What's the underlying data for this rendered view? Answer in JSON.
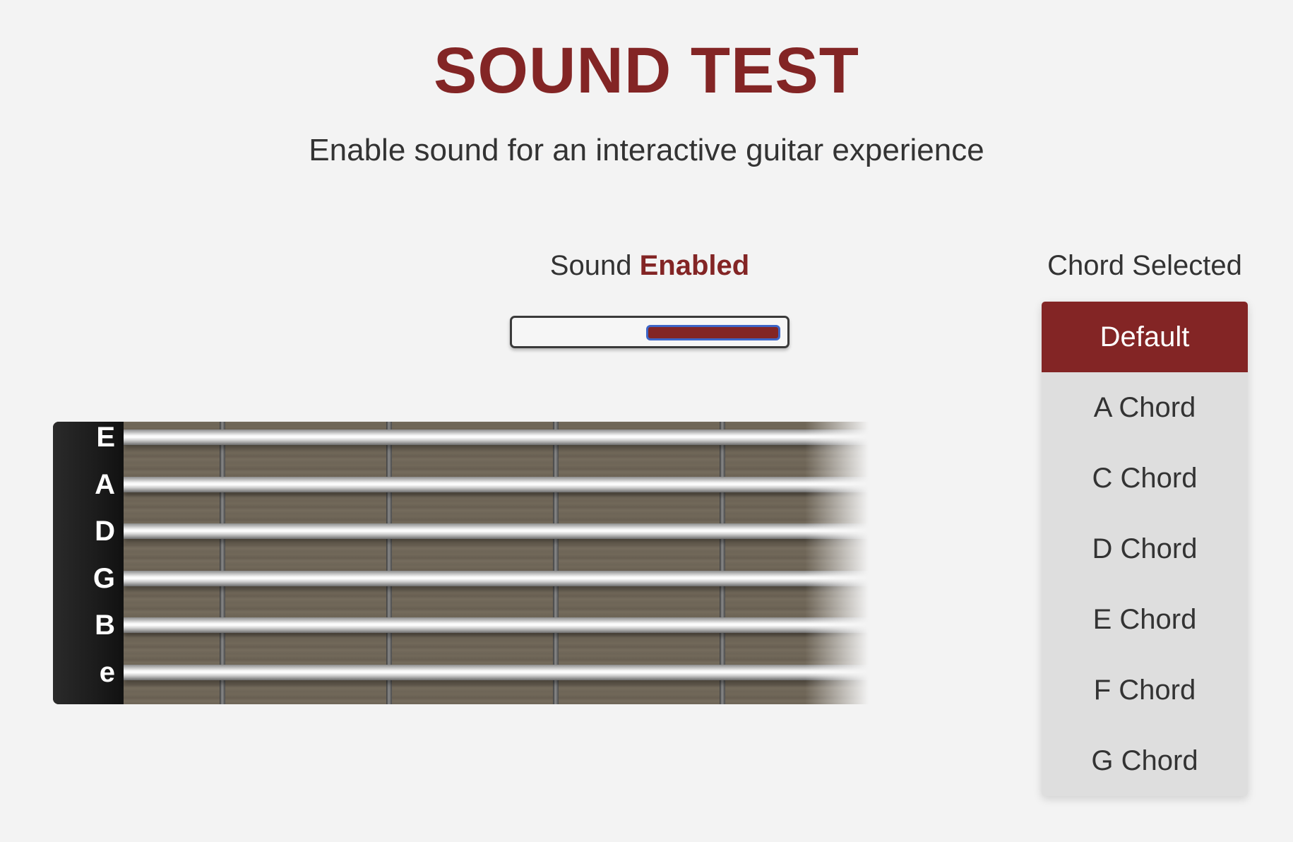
{
  "header": {
    "title": "SOUND TEST",
    "subtitle": "Enable sound for an interactive guitar experience"
  },
  "sound": {
    "label": "Sound",
    "state": "Enabled",
    "enabled": true
  },
  "chords": {
    "title": "Chord Selected",
    "selected": "Default",
    "options": [
      "Default",
      "A Chord",
      "C Chord",
      "D Chord",
      "E Chord",
      "F Chord",
      "G Chord"
    ]
  },
  "fretboard": {
    "strings": [
      "E",
      "A",
      "D",
      "G",
      "B",
      "e"
    ]
  },
  "colors": {
    "accent": "#832525",
    "focus_outline": "#3d66c8",
    "background": "#f3f3f3",
    "list_background": "#dedede"
  }
}
